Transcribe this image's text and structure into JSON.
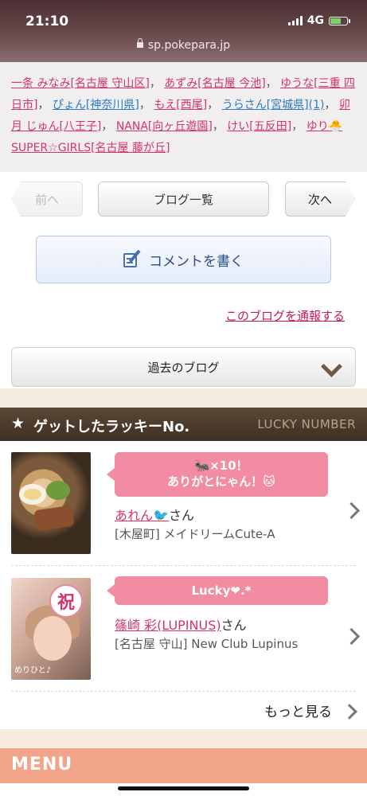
{
  "status": {
    "time": "21:10",
    "network": "4G",
    "url": "sp.pokepara.jp"
  },
  "names": [
    {
      "text": "一条 みなみ[名古屋 守山区]",
      "color": "pink"
    },
    {
      "text": "あずみ[名古屋 今池]",
      "color": "pink"
    },
    {
      "text": "ゆうな[三重 四日市]",
      "color": "pink"
    },
    {
      "text": "ぴょん[神奈川県]",
      "color": "blue"
    },
    {
      "text": "もえ[西尾]",
      "color": "pink"
    },
    {
      "text": "うらさん[宮城県](1)",
      "color": "blue"
    },
    {
      "text": "卯月 じゅん[八王子]",
      "color": "pink"
    },
    {
      "text": "NANA[向ヶ丘遊園]",
      "color": "pink"
    },
    {
      "text": "けい[五反田]",
      "color": "pink"
    },
    {
      "text": "ゆり🐣SUPER☆GIRLS[名古屋 藤が丘]",
      "color": "pink"
    }
  ],
  "pager": {
    "prev": "前へ",
    "list": "ブログ一覧",
    "next": "次へ"
  },
  "comment_button": "コメントを書く",
  "report_link": "このブログを通報する",
  "past_blogs": "過去のブログ",
  "lucky": {
    "title": "ゲットしたラッキーNo.",
    "subtitle": "LUCKY NUMBER",
    "items": [
      {
        "message_line1": "🐜×10！",
        "message_line2": "ありがとにゃん！🐱",
        "name": "あれん🐦",
        "honorific": "さん",
        "shop": "[木屋町] メイドリームCute-A"
      },
      {
        "message_line1": "Lucky❤.*",
        "name": "篠崎 彩(LUPINUS)",
        "honorific": "さん",
        "shop": "[名古屋 守山] New Club Lupinus",
        "thumb_badge": "祝",
        "thumb_caption": "めりひと♪"
      }
    ],
    "more": "もっと見る"
  },
  "menu": {
    "title": "MENU"
  }
}
